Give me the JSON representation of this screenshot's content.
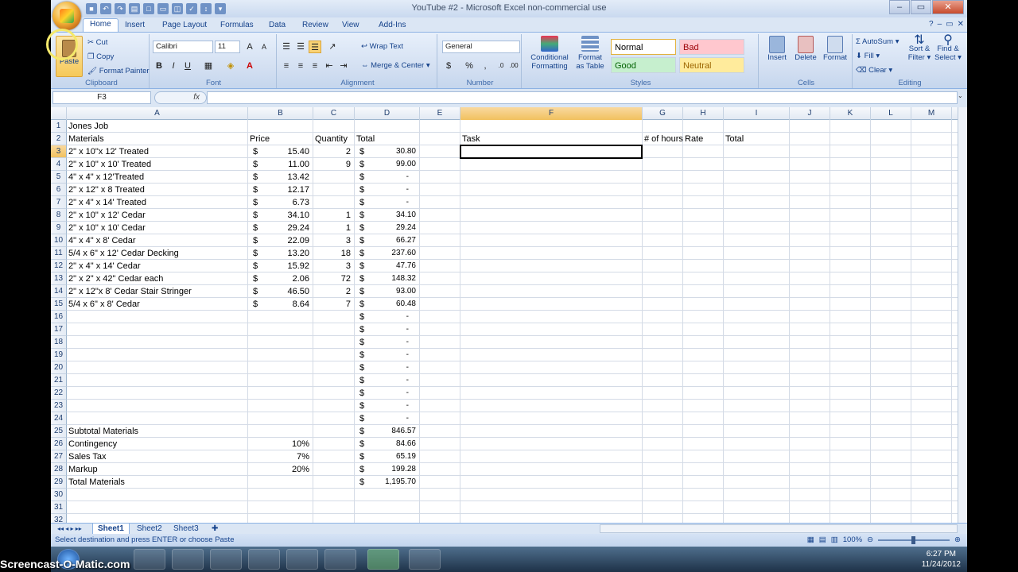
{
  "window": {
    "title": "YouTube #2 - Microsoft Excel non-commercial use",
    "controls": [
      "–",
      "▭",
      "✕"
    ]
  },
  "tabs": [
    "Home",
    "Insert",
    "Page Layout",
    "Formulas",
    "Data",
    "Review",
    "View",
    "Add-Ins"
  ],
  "ribbon": {
    "clipboard": {
      "paste": "Paste",
      "cut": "Cut",
      "copy": "Copy",
      "format_painter": "Format Painter",
      "label": "Clipboard"
    },
    "font": {
      "name": "Calibri",
      "size": "11",
      "bold": "B",
      "italic": "I",
      "underline": "U",
      "label": "Font"
    },
    "alignment": {
      "wrap": "Wrap Text",
      "merge": "Merge & Center",
      "label": "Alignment"
    },
    "number": {
      "format": "General",
      "dollar": "$",
      "percent": "%",
      "comma": ",",
      "label": "Number"
    },
    "styles": {
      "conditional": "Conditional",
      "conditional2": "Formatting",
      "format_table": "Format",
      "format_table2": "as Table",
      "normal": "Normal",
      "bad": "Bad",
      "good": "Good",
      "neutral": "Neutral",
      "label": "Styles"
    },
    "cells": {
      "insert": "Insert",
      "delete": "Delete",
      "format": "Format",
      "label": "Cells"
    },
    "editing": {
      "autosum": "AutoSum",
      "fill": "Fill",
      "clear": "Clear",
      "sort": "Sort &",
      "sort2": "Filter",
      "find": "Find &",
      "find2": "Select",
      "label": "Editing"
    }
  },
  "formula_bar": {
    "name_box": "F3",
    "fx": "fx",
    "value": ""
  },
  "columns": [
    "A",
    "B",
    "C",
    "D",
    "E",
    "F",
    "G",
    "H",
    "I",
    "J",
    "K",
    "L",
    "M"
  ],
  "rows": [
    "1",
    "2",
    "3",
    "4",
    "5",
    "6",
    "7",
    "8",
    "9",
    "10",
    "11",
    "12",
    "13",
    "14",
    "15",
    "16",
    "17",
    "18",
    "19",
    "20",
    "21",
    "22",
    "23",
    "24",
    "25",
    "26",
    "27",
    "28",
    "29",
    "30",
    "31",
    "32"
  ],
  "cells": {
    "A1": "Jones Job",
    "A2": "Materials",
    "B2": "Price",
    "C2": "Quantity",
    "D2": "Total",
    "F2": "Task",
    "G2": "# of hours",
    "H2": "Rate",
    "I2": "Total",
    "A3": "2\" x 10\"x 12' Treated",
    "B3": "15.40",
    "C3": "2",
    "D3": "30.80",
    "A4": "2\" x 10\" x 10' Treated",
    "B4": "11.00",
    "C4": "9",
    "D4": "99.00",
    "A5": "4\" x 4\" x 12'Treated",
    "B5": "13.42",
    "C5": "",
    "D5": "-",
    "A6": "2\" x 12\" x 8 Treated",
    "B6": "12.17",
    "C6": "",
    "D6": "-",
    "A7": "2\" x 4\" x 14' Treated",
    "B7": "6.73",
    "C7": "",
    "D7": "-",
    "A8": "2\" x 10\" x 12' Cedar",
    "B8": "34.10",
    "C8": "1",
    "D8": "34.10",
    "A9": "2\" x 10\" x 10' Cedar",
    "B9": "29.24",
    "C9": "1",
    "D9": "29.24",
    "A10": "4\" x 4\" x 8' Cedar",
    "B10": "22.09",
    "C10": "3",
    "D10": "66.27",
    "A11": "5/4 x 6\" x 12' Cedar Decking",
    "B11": "13.20",
    "C11": "18",
    "D11": "237.60",
    "A12": "2\" x 4\" x 14' Cedar",
    "B12": "15.92",
    "C12": "3",
    "D12": "47.76",
    "A13": "2\" x 2\" x 42\" Cedar  each",
    "B13": "2.06",
    "C13": "72",
    "D13": "148.32",
    "A14": "2\" x 12\"x 8'  Cedar Stair Stringer",
    "B14": "46.50",
    "C14": "2",
    "D14": "93.00",
    "A15": "5/4 x 6\" x 8' Cedar",
    "B15": "8.64",
    "C15": "7",
    "D15": "60.48",
    "D16": "-",
    "D17": "-",
    "D18": "-",
    "D19": "-",
    "D20": "-",
    "D21": "-",
    "D22": "-",
    "D23": "-",
    "D24": "-",
    "A25": "Subtotal Materials",
    "D25": "846.57",
    "A26": "Contingency",
    "B26": "10%",
    "D26": "84.66",
    "A27": "Sales Tax",
    "B27": "7%",
    "D27": "65.19",
    "A28": "Markup",
    "B28": "20%",
    "D28": "199.28",
    "A29": "Total Materials",
    "D29": "1,195.70"
  },
  "currency_symbol": "$",
  "sheets": [
    "Sheet1",
    "Sheet2",
    "Sheet3"
  ],
  "status": {
    "message": "Select destination and press ENTER or choose Paste",
    "zoom": "100%"
  },
  "taskbar": {
    "time": "6:27 PM",
    "date": "11/24/2012"
  },
  "watermark": "Screencast-O-Matic.com"
}
